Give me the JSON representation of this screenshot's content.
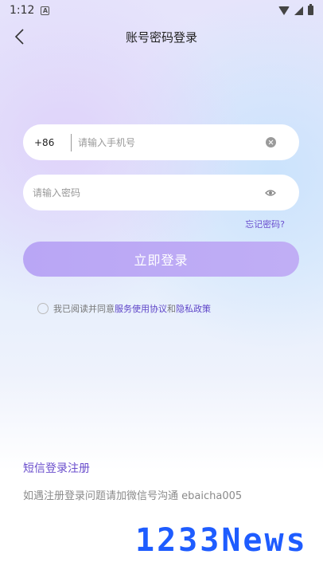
{
  "status_bar": {
    "time": "1:12",
    "notification": "A"
  },
  "header": {
    "title": "账号密码登录"
  },
  "phone": {
    "country_code": "+86",
    "placeholder": "请输入手机号"
  },
  "password": {
    "placeholder": "请输入密码"
  },
  "forgot_label": "忘记密码?",
  "login_label": "立即登录",
  "agreement": {
    "prefix": "我已阅读并同意",
    "service": "服务使用协议",
    "and": "和",
    "privacy": "隐私政策"
  },
  "sms_label": "短信登录注册",
  "help_text": "如遇注册登录问题请加微信号沟通 ebaicha005",
  "watermark": "1233News",
  "colors": {
    "accent": "#6b4fcf",
    "button": "#bba8f5",
    "watermark": "#1e5cff"
  }
}
